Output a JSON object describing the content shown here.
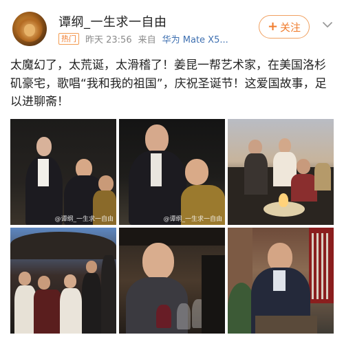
{
  "header": {
    "user_name": "谭纲_一生求一自由",
    "badge": "热门",
    "time": "昨天 23:56",
    "source_prefix": "来自",
    "device": "华为 Mate X5...",
    "follow_label": "关注",
    "follow_icon": "plus-icon",
    "menu_icon": "chevron-down-icon"
  },
  "post": {
    "text": "太魔幻了，太荒诞，太滑稽了！姜昆一帮艺术家，在美国洛杉矶豪宅，歌唱“我和我的祖国”，庆祝圣诞节！这爱国故事，足以进聊斋！"
  },
  "photos": [
    {
      "watermark": "@谭纲_一生求一自由"
    },
    {
      "watermark": "@谭纲_一生求一自由"
    },
    {
      "watermark": ""
    },
    {
      "watermark": ""
    },
    {
      "watermark": ""
    },
    {
      "watermark": ""
    }
  ],
  "colors": {
    "accent": "#f07c2d",
    "device_link": "#3d6fb0",
    "meta_text": "#8a8a8a"
  }
}
